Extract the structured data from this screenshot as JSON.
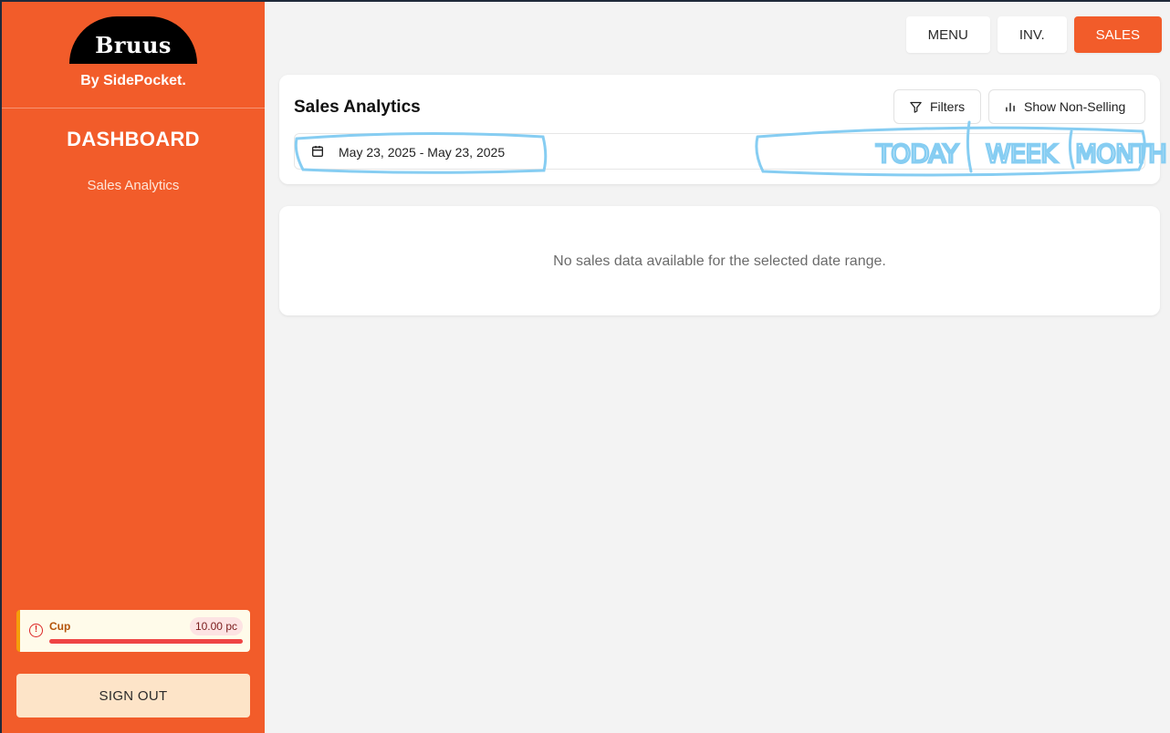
{
  "sidebar": {
    "logo_text": "Bruus",
    "byline": "By SidePocket.",
    "title": "DASHBOARD",
    "items": [
      {
        "label": "Sales Analytics"
      }
    ],
    "alert": {
      "name": "Cup",
      "quantity": "10.00 pc",
      "level": 1.0
    },
    "sign_out_label": "SIGN OUT"
  },
  "topnav": {
    "menu_label": "MENU",
    "inv_label": "INV.",
    "sales_label": "SALES",
    "active": "SALES"
  },
  "analytics": {
    "title": "Sales Analytics",
    "filters_label": "Filters",
    "non_selling_label": "Show Non-Selling",
    "date_range": "May 23, 2025 - May 23, 2025"
  },
  "empty_message": "No sales data available for the selected date range.",
  "annotations": {
    "today": "TODAY",
    "week": "WEEK",
    "month": "MONTH"
  },
  "colors": {
    "accent": "#f25c2a",
    "annotation": "#86cdf2",
    "alert_bar": "#ef4444"
  },
  "icons": [
    "calendar-icon",
    "filter-icon",
    "bar-chart-icon",
    "alert-circle-icon"
  ]
}
